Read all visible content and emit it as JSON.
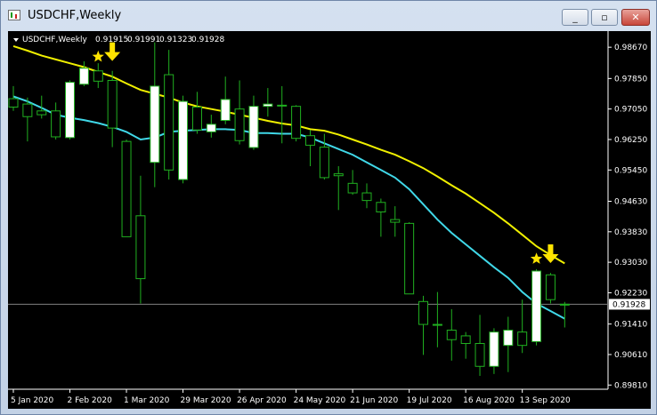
{
  "window": {
    "title": "USDCHF,Weekly",
    "minimize_glyph": "_",
    "restore_glyph": "▫",
    "close_glyph": "✕"
  },
  "colors": {
    "background": "#000000",
    "bull_candle": "#ffffff",
    "wick": "#20b020",
    "ma_fast": "#40d8e8",
    "ma_slow": "#f0f000",
    "marker": "#ffe400",
    "axis_text": "#ffffff",
    "price_line": "#808080"
  },
  "chart_data": {
    "type": "candlestick",
    "title": "USDCHF,Weekly",
    "ohlc_header": {
      "symbol_label": "USDCHF,Weekly",
      "open": "0.91915",
      "high": "0.91991",
      "low": "0.91323",
      "close": "0.91928"
    },
    "current_price_label": "0.91928",
    "ylim": [
      0.897,
      0.99
    ],
    "y_ticks": [
      "0.98670",
      "0.97850",
      "0.97050",
      "0.96250",
      "0.95450",
      "0.94630",
      "0.93830",
      "0.93030",
      "0.92230",
      "0.91410",
      "0.90610",
      "0.89810"
    ],
    "x_ticks": [
      "5 Jan 2020",
      "2 Feb 2020",
      "1 Mar 2020",
      "29 Mar 2020",
      "26 Apr 2020",
      "24 May 2020",
      "21 Jun 2020",
      "19 Jul 2020",
      "16 Aug 2020",
      "13 Sep 2020"
    ],
    "x_tick_index": [
      0,
      4,
      8,
      12,
      16,
      20,
      24,
      28,
      32,
      36
    ],
    "candles": [
      {
        "o": 0.9732,
        "h": 0.9765,
        "l": 0.97,
        "c": 0.971
      },
      {
        "o": 0.9718,
        "h": 0.9735,
        "l": 0.962,
        "c": 0.9685
      },
      {
        "o": 0.97,
        "h": 0.974,
        "l": 0.968,
        "c": 0.969
      },
      {
        "o": 0.97,
        "h": 0.9722,
        "l": 0.9625,
        "c": 0.9632
      },
      {
        "o": 0.963,
        "h": 0.978,
        "l": 0.9625,
        "c": 0.9775
      },
      {
        "o": 0.977,
        "h": 0.983,
        "l": 0.9765,
        "c": 0.9812
      },
      {
        "o": 0.9805,
        "h": 0.9825,
        "l": 0.976,
        "c": 0.9778
      },
      {
        "o": 0.978,
        "h": 0.9805,
        "l": 0.9605,
        "c": 0.9655
      },
      {
        "o": 0.962,
        "h": 0.9625,
        "l": 0.937,
        "c": 0.937
      },
      {
        "o": 0.9425,
        "h": 0.953,
        "l": 0.9195,
        "c": 0.926
      },
      {
        "o": 0.9565,
        "h": 0.988,
        "l": 0.95,
        "c": 0.9765
      },
      {
        "o": 0.9795,
        "h": 0.986,
        "l": 0.952,
        "c": 0.9545
      },
      {
        "o": 0.952,
        "h": 0.974,
        "l": 0.951,
        "c": 0.9725
      },
      {
        "o": 0.971,
        "h": 0.975,
        "l": 0.964,
        "c": 0.965
      },
      {
        "o": 0.9645,
        "h": 0.969,
        "l": 0.963,
        "c": 0.9665
      },
      {
        "o": 0.9675,
        "h": 0.979,
        "l": 0.9665,
        "c": 0.973
      },
      {
        "o": 0.9705,
        "h": 0.978,
        "l": 0.9612,
        "c": 0.9622
      },
      {
        "o": 0.9604,
        "h": 0.974,
        "l": 0.9598,
        "c": 0.9712
      },
      {
        "o": 0.9712,
        "h": 0.976,
        "l": 0.9685,
        "c": 0.9718
      },
      {
        "o": 0.9715,
        "h": 0.9765,
        "l": 0.9615,
        "c": 0.9715
      },
      {
        "o": 0.9712,
        "h": 0.9715,
        "l": 0.962,
        "c": 0.9628
      },
      {
        "o": 0.9635,
        "h": 0.965,
        "l": 0.9555,
        "c": 0.961
      },
      {
        "o": 0.9605,
        "h": 0.964,
        "l": 0.952,
        "c": 0.9525
      },
      {
        "o": 0.9535,
        "h": 0.9555,
        "l": 0.944,
        "c": 0.953
      },
      {
        "o": 0.951,
        "h": 0.9545,
        "l": 0.948,
        "c": 0.9485
      },
      {
        "o": 0.9485,
        "h": 0.951,
        "l": 0.9445,
        "c": 0.9465
      },
      {
        "o": 0.946,
        "h": 0.947,
        "l": 0.937,
        "c": 0.9435
      },
      {
        "o": 0.9415,
        "h": 0.945,
        "l": 0.937,
        "c": 0.9408
      },
      {
        "o": 0.9405,
        "h": 0.9408,
        "l": 0.922,
        "c": 0.922
      },
      {
        "o": 0.92,
        "h": 0.9215,
        "l": 0.906,
        "c": 0.914
      },
      {
        "o": 0.914,
        "h": 0.9225,
        "l": 0.908,
        "c": 0.914
      },
      {
        "o": 0.9125,
        "h": 0.918,
        "l": 0.9045,
        "c": 0.91
      },
      {
        "o": 0.911,
        "h": 0.912,
        "l": 0.905,
        "c": 0.909
      },
      {
        "o": 0.909,
        "h": 0.9165,
        "l": 0.9005,
        "c": 0.903
      },
      {
        "o": 0.903,
        "h": 0.913,
        "l": 0.901,
        "c": 0.912
      },
      {
        "o": 0.9085,
        "h": 0.916,
        "l": 0.9015,
        "c": 0.9125
      },
      {
        "o": 0.912,
        "h": 0.9205,
        "l": 0.9065,
        "c": 0.9085
      },
      {
        "o": 0.9095,
        "h": 0.9285,
        "l": 0.9085,
        "c": 0.928
      },
      {
        "o": 0.927,
        "h": 0.9275,
        "l": 0.9195,
        "c": 0.9205
      },
      {
        "o": 0.9192,
        "h": 0.9199,
        "l": 0.9132,
        "c": 0.9193
      }
    ],
    "ma_fast": [
      0.9738,
      0.9725,
      0.9708,
      0.969,
      0.9682,
      0.9676,
      0.9668,
      0.9658,
      0.9645,
      0.9625,
      0.963,
      0.9645,
      0.9648,
      0.965,
      0.9652,
      0.9652,
      0.965,
      0.9642,
      0.9642,
      0.964,
      0.964,
      0.963,
      0.9615,
      0.96,
      0.9585,
      0.9565,
      0.9545,
      0.9525,
      0.9495,
      0.9455,
      0.9415,
      0.938,
      0.935,
      0.932,
      0.929,
      0.9262,
      0.9225,
      0.9195,
      0.9175,
      0.9155
    ],
    "ma_slow": [
      0.987,
      0.9858,
      0.9845,
      0.9835,
      0.9825,
      0.9815,
      0.9802,
      0.979,
      0.9772,
      0.9755,
      0.9745,
      0.9735,
      0.9722,
      0.9712,
      0.9705,
      0.9698,
      0.969,
      0.9682,
      0.9674,
      0.9667,
      0.9662,
      0.9652,
      0.9648,
      0.9638,
      0.9625,
      0.9612,
      0.9598,
      0.9585,
      0.9568,
      0.955,
      0.9528,
      0.9505,
      0.9483,
      0.9458,
      0.9433,
      0.9405,
      0.9375,
      0.9345,
      0.9322,
      0.93
    ],
    "markers": [
      {
        "type": "star",
        "index": 6,
        "price": 0.9842
      },
      {
        "type": "down-arrow",
        "index": 7,
        "price": 0.9852
      },
      {
        "type": "star",
        "index": 37,
        "price": 0.9312
      },
      {
        "type": "down-arrow",
        "index": 38,
        "price": 0.9322
      }
    ]
  }
}
